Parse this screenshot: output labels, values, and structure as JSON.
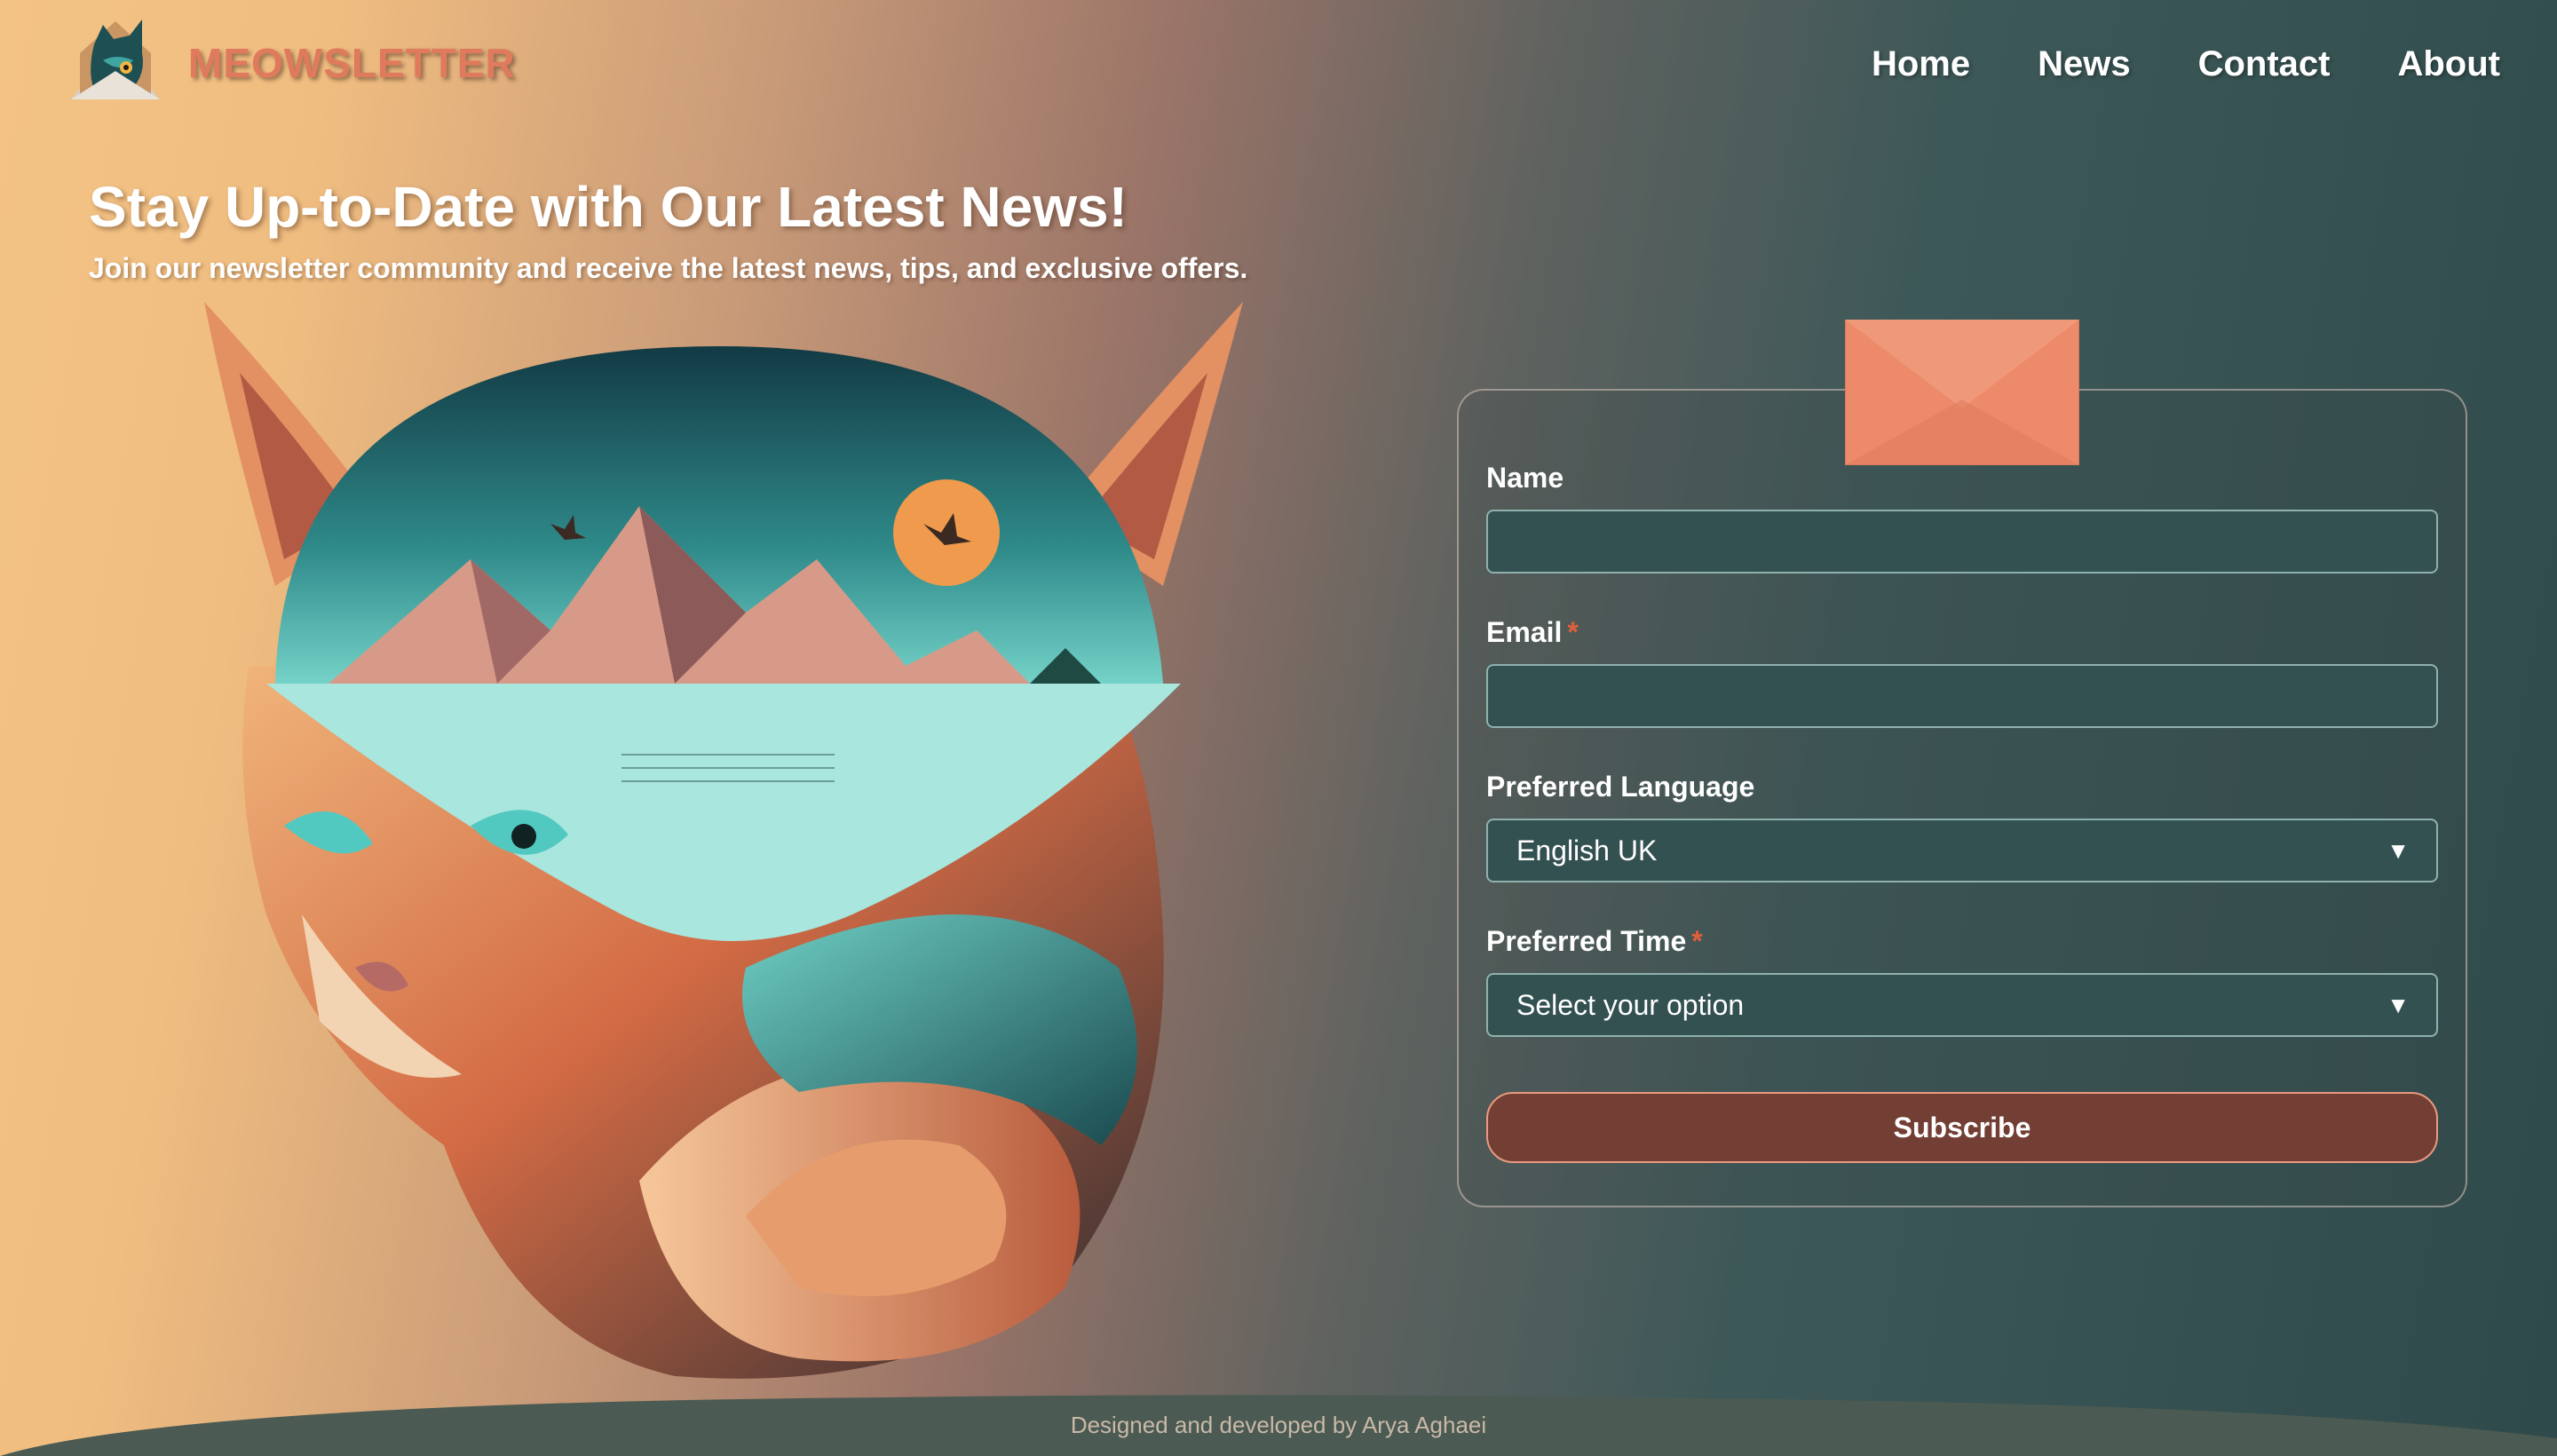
{
  "brand": {
    "name": "MEOWSLETTER",
    "accent": "#e07a5c"
  },
  "nav": {
    "items": [
      "Home",
      "News",
      "Contact",
      "About"
    ]
  },
  "hero": {
    "title": "Stay Up-to-Date with Our Latest News!",
    "subtitle": "Join our newsletter community and receive the latest news, tips, and exclusive offers."
  },
  "form": {
    "name": {
      "label": "Name",
      "value": ""
    },
    "email": {
      "label": "Email",
      "required": "*",
      "value": ""
    },
    "language": {
      "label": "Preferred Language",
      "selected": "English UK"
    },
    "time": {
      "label": "Preferred Time",
      "required": "*",
      "selected": "Select your option"
    },
    "submit_label": "Subscribe",
    "envelope_color": "#ec8a6a"
  },
  "footer": {
    "credit": "Designed and developed by Arya Aghaei"
  },
  "icons": {
    "logo": "cat-envelope-logo-icon",
    "envelope": "envelope-icon",
    "dropdown": "chevron-down-icon"
  }
}
